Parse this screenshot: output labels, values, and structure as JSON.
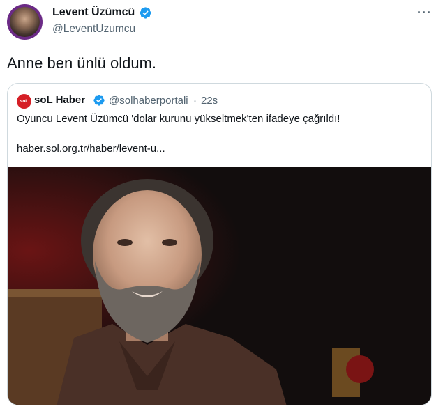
{
  "tweet": {
    "author": {
      "name": "Levent Üzümcü",
      "handle": "@LeventUzumcu",
      "verified": true
    },
    "text": "Anne ben ünlü oldum.",
    "more_icon": "more-horizontal-icon",
    "quoted": {
      "logo_text": "soL",
      "name": "soL Haber",
      "verified": true,
      "handle": "@solhaberportali",
      "separator": "·",
      "time": "22s",
      "text": "Oyuncu Levent Üzümcü 'dolar kurunu yükseltmek'ten ifadeye çağrıldı!",
      "link": "haber.sol.org.tr/haber/levent-u..."
    }
  },
  "colors": {
    "text": "#0f1419",
    "secondary": "#536471",
    "verified_blue": "#1d9bf0",
    "border": "#cfd9de",
    "sol_red": "#d51f26",
    "avatar_ring": "#6b2a86"
  }
}
